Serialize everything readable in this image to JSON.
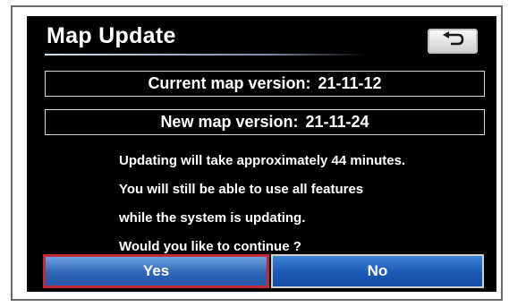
{
  "dialog": {
    "title": "Map Update",
    "back_icon": "return-arrow-icon",
    "current_version": {
      "label": "Current map version:",
      "value": "21-11-12"
    },
    "new_version": {
      "label": "New map version:",
      "value": "21-11-24"
    },
    "message_lines": [
      "Updating will take approximately 44 minutes.",
      "You will still be able to use all features",
      "while the system is updating.",
      "Would you like to continue ?"
    ],
    "yes_label": "Yes",
    "no_label": "No"
  },
  "colors": {
    "screen_bg": "#000000",
    "button_blue": "#1a59b5",
    "selected_border": "#c22a3a"
  }
}
